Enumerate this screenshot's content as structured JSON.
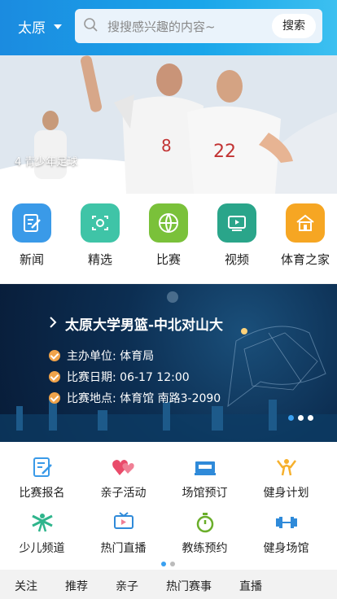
{
  "header": {
    "city": "太原",
    "search_placeholder": "搜搜感兴趣的内容~",
    "search_button": "搜索"
  },
  "hero": {
    "caption": "4 青少年足球",
    "jersey_left": "8",
    "jersey_right": "22"
  },
  "categories": [
    {
      "label": "新闻",
      "icon": "news-icon",
      "color": "#3a9ae8"
    },
    {
      "label": "精选",
      "icon": "camera-icon",
      "color": "#3fc4a7"
    },
    {
      "label": "比赛",
      "icon": "basketball-icon",
      "color": "#7ac13a"
    },
    {
      "label": "视频",
      "icon": "video-icon",
      "color": "#2aa58a"
    },
    {
      "label": "体育之家",
      "icon": "home-icon",
      "color": "#f6a623"
    }
  ],
  "banner": {
    "title": "太原大学男篮-中北对山大",
    "organizer": "主办单位: 体育局",
    "date": "比赛日期: 06-17 12:00",
    "location": "比赛地点: 体育馆 南路3-2090"
  },
  "services": [
    {
      "label": "比赛报名",
      "icon": "signup-icon",
      "color": "#3a9ae8"
    },
    {
      "label": "亲子活动",
      "icon": "hearts-icon",
      "color": "#e94b6a"
    },
    {
      "label": "场馆预订",
      "icon": "venue-icon",
      "color": "#2f8ad9"
    },
    {
      "label": "健身计划",
      "icon": "fitness-plan-icon",
      "color": "#f6b02c"
    },
    {
      "label": "少儿频道",
      "icon": "kids-icon",
      "color": "#2fb58c"
    },
    {
      "label": "热门直播",
      "icon": "live-tv-icon",
      "color": "#2f8ad9"
    },
    {
      "label": "教练预约",
      "icon": "stopwatch-icon",
      "color": "#6aae2a"
    },
    {
      "label": "健身场馆",
      "icon": "dumbbell-icon",
      "color": "#2f8ad9"
    }
  ],
  "bottom_tabs": [
    "关注",
    "推荐",
    "亲子",
    "热门赛事",
    "直播"
  ]
}
